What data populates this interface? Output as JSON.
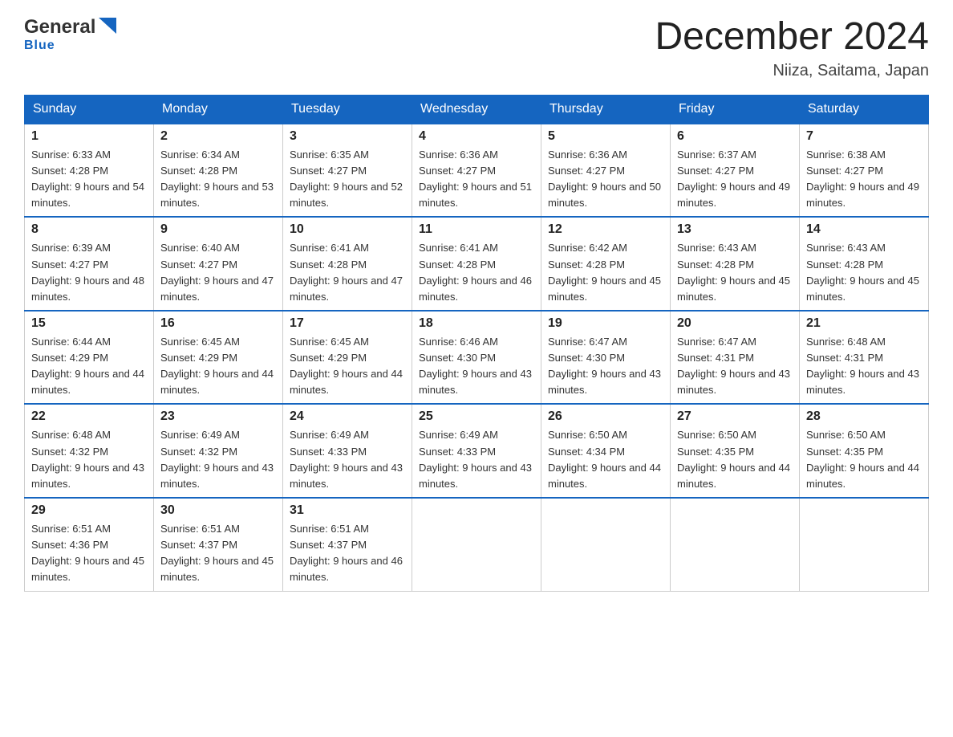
{
  "header": {
    "logo_general": "General",
    "logo_blue": "Blue",
    "month_title": "December 2024",
    "location": "Niiza, Saitama, Japan"
  },
  "days_of_week": [
    "Sunday",
    "Monday",
    "Tuesday",
    "Wednesday",
    "Thursday",
    "Friday",
    "Saturday"
  ],
  "weeks": [
    [
      {
        "day": "1",
        "sunrise": "6:33 AM",
        "sunset": "4:28 PM",
        "daylight": "9 hours and 54 minutes."
      },
      {
        "day": "2",
        "sunrise": "6:34 AM",
        "sunset": "4:28 PM",
        "daylight": "9 hours and 53 minutes."
      },
      {
        "day": "3",
        "sunrise": "6:35 AM",
        "sunset": "4:27 PM",
        "daylight": "9 hours and 52 minutes."
      },
      {
        "day": "4",
        "sunrise": "6:36 AM",
        "sunset": "4:27 PM",
        "daylight": "9 hours and 51 minutes."
      },
      {
        "day": "5",
        "sunrise": "6:36 AM",
        "sunset": "4:27 PM",
        "daylight": "9 hours and 50 minutes."
      },
      {
        "day": "6",
        "sunrise": "6:37 AM",
        "sunset": "4:27 PM",
        "daylight": "9 hours and 49 minutes."
      },
      {
        "day": "7",
        "sunrise": "6:38 AM",
        "sunset": "4:27 PM",
        "daylight": "9 hours and 49 minutes."
      }
    ],
    [
      {
        "day": "8",
        "sunrise": "6:39 AM",
        "sunset": "4:27 PM",
        "daylight": "9 hours and 48 minutes."
      },
      {
        "day": "9",
        "sunrise": "6:40 AM",
        "sunset": "4:27 PM",
        "daylight": "9 hours and 47 minutes."
      },
      {
        "day": "10",
        "sunrise": "6:41 AM",
        "sunset": "4:28 PM",
        "daylight": "9 hours and 47 minutes."
      },
      {
        "day": "11",
        "sunrise": "6:41 AM",
        "sunset": "4:28 PM",
        "daylight": "9 hours and 46 minutes."
      },
      {
        "day": "12",
        "sunrise": "6:42 AM",
        "sunset": "4:28 PM",
        "daylight": "9 hours and 45 minutes."
      },
      {
        "day": "13",
        "sunrise": "6:43 AM",
        "sunset": "4:28 PM",
        "daylight": "9 hours and 45 minutes."
      },
      {
        "day": "14",
        "sunrise": "6:43 AM",
        "sunset": "4:28 PM",
        "daylight": "9 hours and 45 minutes."
      }
    ],
    [
      {
        "day": "15",
        "sunrise": "6:44 AM",
        "sunset": "4:29 PM",
        "daylight": "9 hours and 44 minutes."
      },
      {
        "day": "16",
        "sunrise": "6:45 AM",
        "sunset": "4:29 PM",
        "daylight": "9 hours and 44 minutes."
      },
      {
        "day": "17",
        "sunrise": "6:45 AM",
        "sunset": "4:29 PM",
        "daylight": "9 hours and 44 minutes."
      },
      {
        "day": "18",
        "sunrise": "6:46 AM",
        "sunset": "4:30 PM",
        "daylight": "9 hours and 43 minutes."
      },
      {
        "day": "19",
        "sunrise": "6:47 AM",
        "sunset": "4:30 PM",
        "daylight": "9 hours and 43 minutes."
      },
      {
        "day": "20",
        "sunrise": "6:47 AM",
        "sunset": "4:31 PM",
        "daylight": "9 hours and 43 minutes."
      },
      {
        "day": "21",
        "sunrise": "6:48 AM",
        "sunset": "4:31 PM",
        "daylight": "9 hours and 43 minutes."
      }
    ],
    [
      {
        "day": "22",
        "sunrise": "6:48 AM",
        "sunset": "4:32 PM",
        "daylight": "9 hours and 43 minutes."
      },
      {
        "day": "23",
        "sunrise": "6:49 AM",
        "sunset": "4:32 PM",
        "daylight": "9 hours and 43 minutes."
      },
      {
        "day": "24",
        "sunrise": "6:49 AM",
        "sunset": "4:33 PM",
        "daylight": "9 hours and 43 minutes."
      },
      {
        "day": "25",
        "sunrise": "6:49 AM",
        "sunset": "4:33 PM",
        "daylight": "9 hours and 43 minutes."
      },
      {
        "day": "26",
        "sunrise": "6:50 AM",
        "sunset": "4:34 PM",
        "daylight": "9 hours and 44 minutes."
      },
      {
        "day": "27",
        "sunrise": "6:50 AM",
        "sunset": "4:35 PM",
        "daylight": "9 hours and 44 minutes."
      },
      {
        "day": "28",
        "sunrise": "6:50 AM",
        "sunset": "4:35 PM",
        "daylight": "9 hours and 44 minutes."
      }
    ],
    [
      {
        "day": "29",
        "sunrise": "6:51 AM",
        "sunset": "4:36 PM",
        "daylight": "9 hours and 45 minutes."
      },
      {
        "day": "30",
        "sunrise": "6:51 AM",
        "sunset": "4:37 PM",
        "daylight": "9 hours and 45 minutes."
      },
      {
        "day": "31",
        "sunrise": "6:51 AM",
        "sunset": "4:37 PM",
        "daylight": "9 hours and 46 minutes."
      },
      null,
      null,
      null,
      null
    ]
  ]
}
